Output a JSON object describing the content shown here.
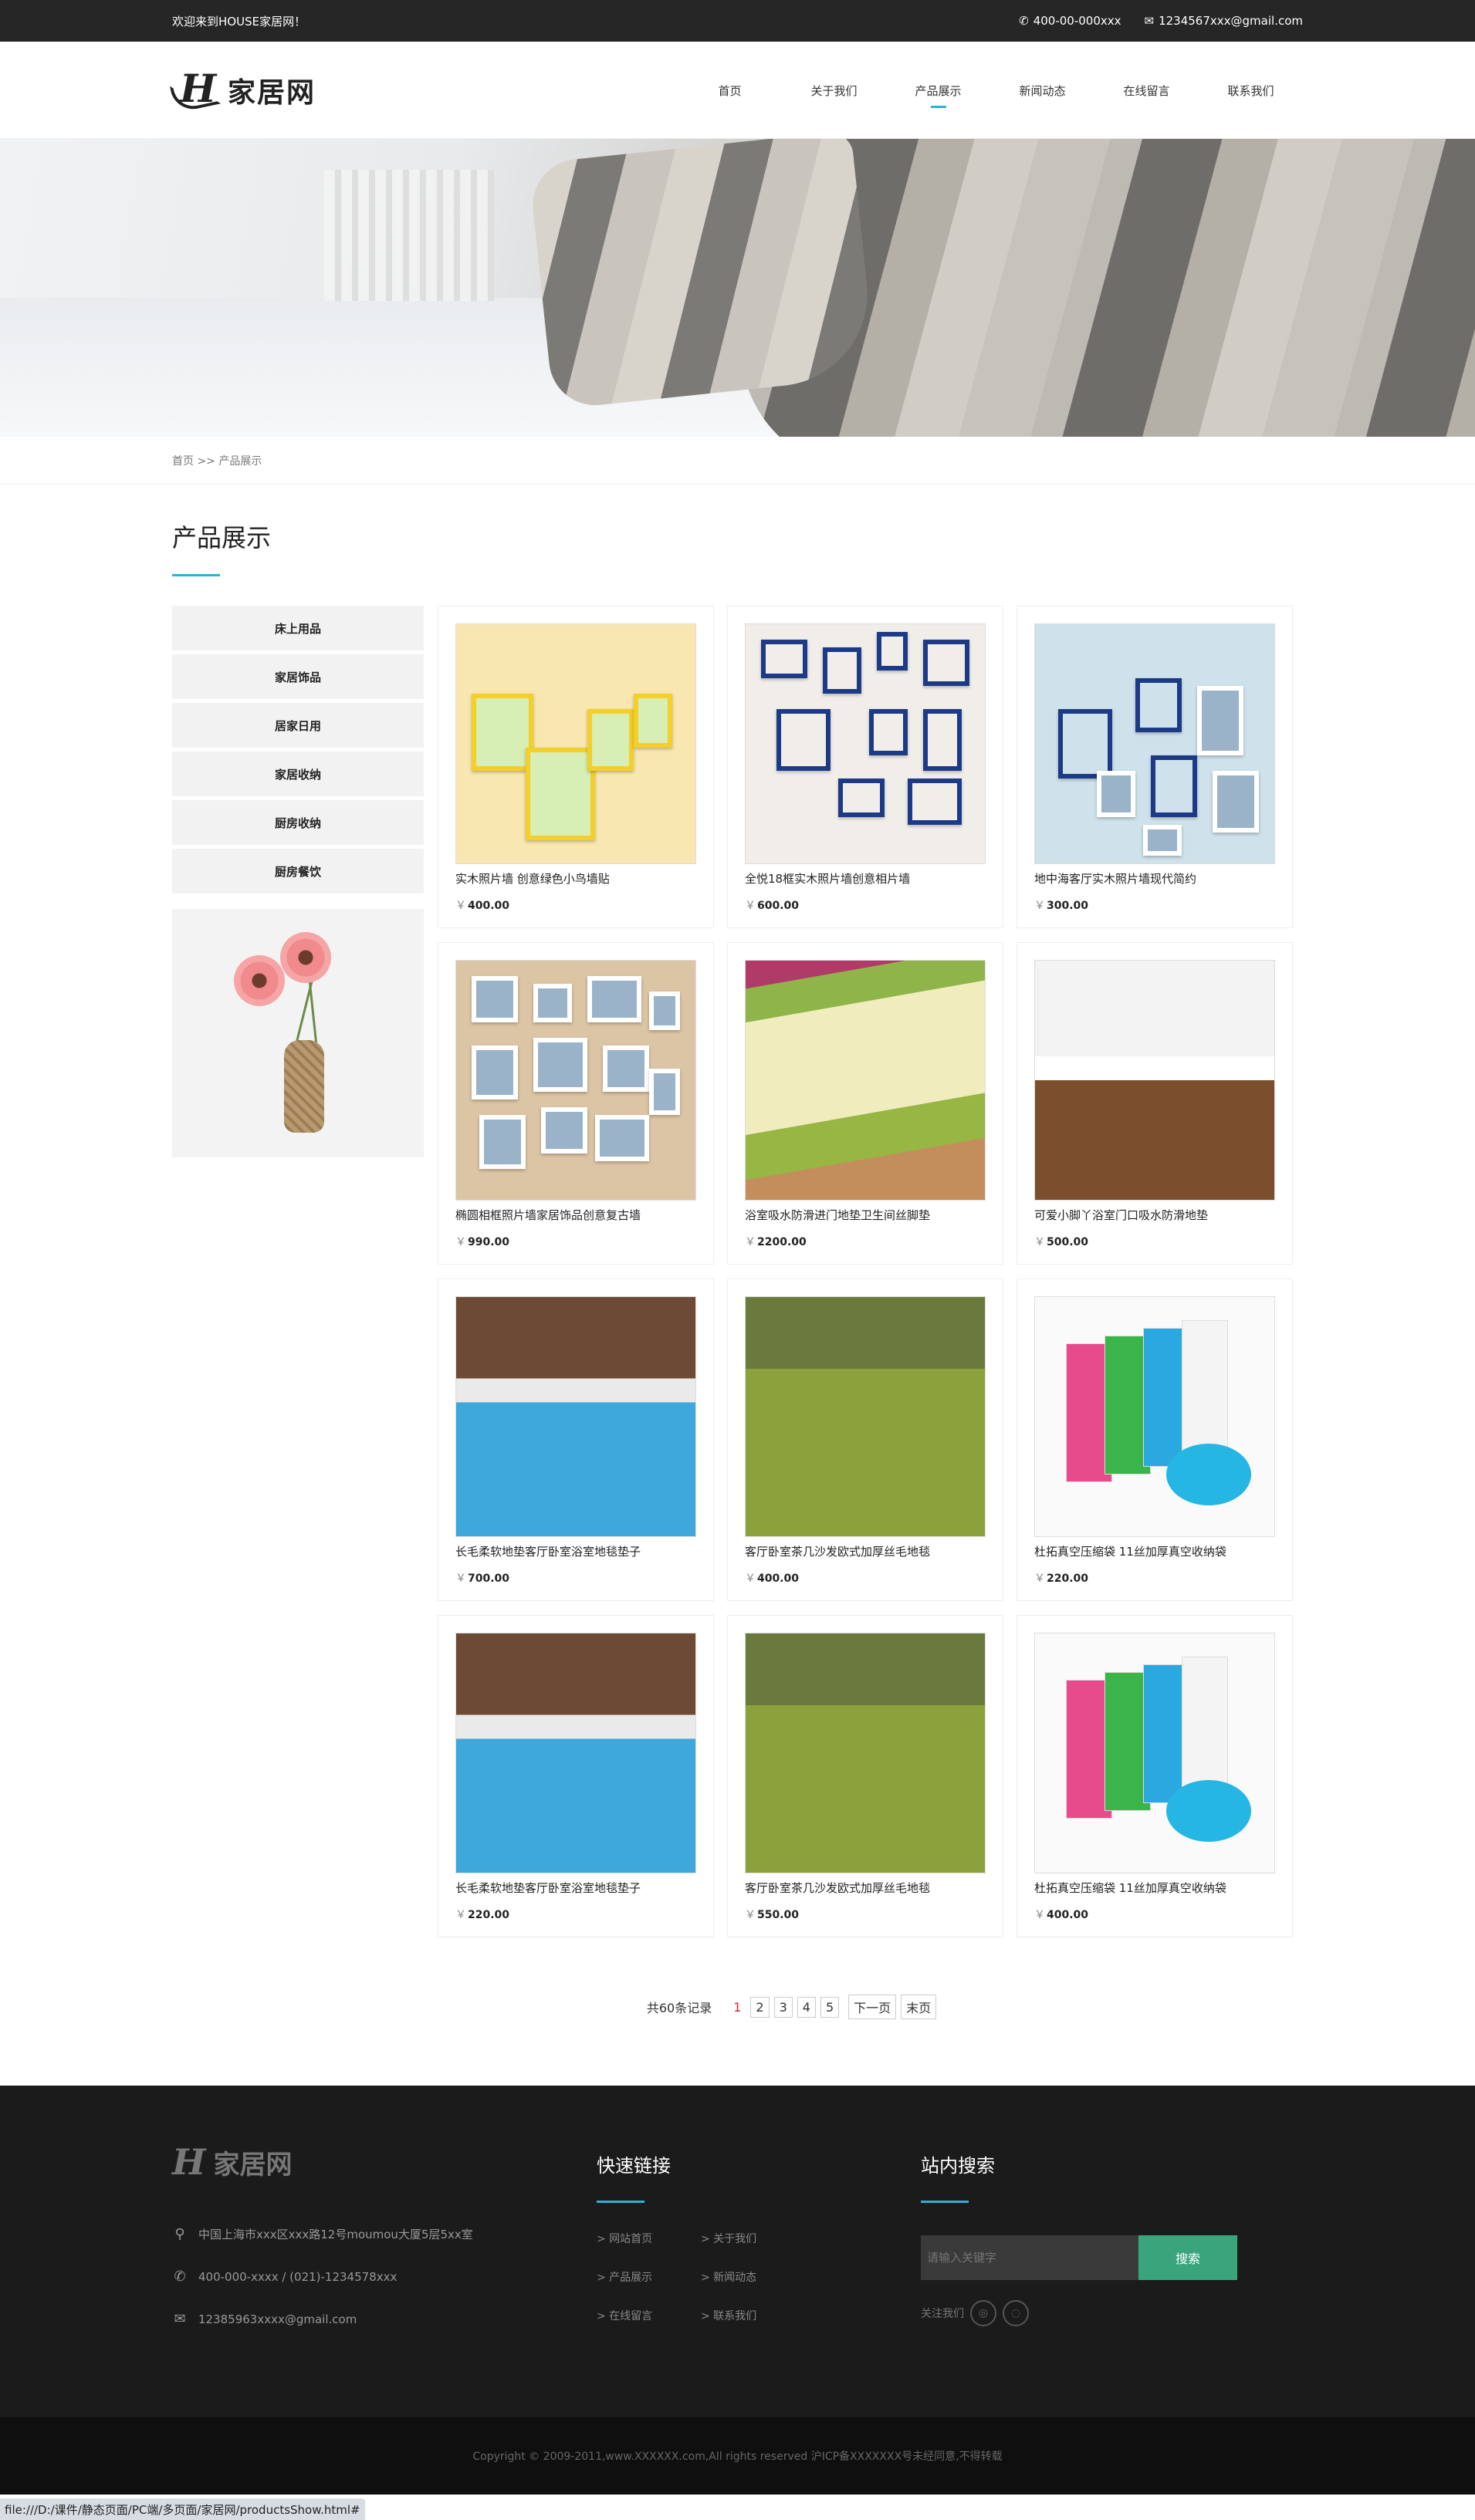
{
  "topbar": {
    "welcome": "欢迎来到HOUSE家居网！",
    "phone": "400-00-000xxx",
    "email": "1234567xxx@gmail.com"
  },
  "header": {
    "logo_letter": "H",
    "logo_text": "家居网",
    "nav": [
      {
        "label": "首页",
        "active": false
      },
      {
        "label": "关于我们",
        "active": false
      },
      {
        "label": "产品展示",
        "active": true
      },
      {
        "label": "新闻动态",
        "active": false
      },
      {
        "label": "在线留言",
        "active": false
      },
      {
        "label": "联系我们",
        "active": false
      }
    ]
  },
  "breadcrumb": "首页 >> 产品展示",
  "section_title": "产品展示",
  "categories": [
    "床上用品",
    "家居饰品",
    "居家日用",
    "家居收纳",
    "厨房收纳",
    "厨房餐饮"
  ],
  "products": [
    {
      "name": "实木照片墙 创意绿色小鸟墙贴",
      "price": "400.00",
      "art": "wall1"
    },
    {
      "name": "全悦18框实木照片墙创意相片墙",
      "price": "600.00",
      "art": "wall2"
    },
    {
      "name": "地中海客厅实木照片墙现代简约",
      "price": "300.00",
      "art": "wall3"
    },
    {
      "name": "椭圆相框照片墙家居饰品创意复古墙",
      "price": "990.00",
      "art": "wall4"
    },
    {
      "name": "浴室吸水防滑进门地垫卫生间丝脚垫",
      "price": "2200.00",
      "art": "rug1"
    },
    {
      "name": "可爱小脚丫浴室门口吸水防滑地垫",
      "price": "500.00",
      "art": "rug2"
    },
    {
      "name": "长毛柔软地垫客厅卧室浴室地毯垫子",
      "price": "700.00",
      "art": "blue"
    },
    {
      "name": "客厅卧室茶几沙发欧式加厚丝毛地毯",
      "price": "400.00",
      "art": "green"
    },
    {
      "name": "杜拓真空压缩袋 11丝加厚真空收纳袋",
      "price": "220.00",
      "art": "bag"
    },
    {
      "name": "长毛柔软地垫客厅卧室浴室地毯垫子",
      "price": "220.00",
      "art": "blue"
    },
    {
      "name": "客厅卧室茶几沙发欧式加厚丝毛地毯",
      "price": "550.00",
      "art": "green"
    },
    {
      "name": "杜拓真空压缩袋 11丝加厚真空收纳袋",
      "price": "400.00",
      "art": "bag"
    }
  ],
  "currency": "￥",
  "pager": {
    "total": "共60条记录",
    "current": "1",
    "pages": [
      "2",
      "3",
      "4",
      "5"
    ],
    "next": "下一页",
    "last": "末页"
  },
  "footer": {
    "logo_letter": "H",
    "logo_text": "家居网",
    "address": "中国上海市xxx区xxx路12号moumou大厦5层5xx室",
    "phone": "400-000-xxxx / (021)-1234578xxx",
    "email": "12385963xxxx@gmail.com",
    "links_title": "快速链接",
    "links": [
      "> 网站首页",
      "> 关于我们",
      "> 产品展示",
      "> 新闻动态",
      "> 在线留言",
      "> 联系我们"
    ],
    "search_title": "站内搜索",
    "search_placeholder": "请输入关键字",
    "search_button": "搜索",
    "follow_label": "关注我们"
  },
  "copyright": "Copyright © 2009-2011,www.XXXXXX.com,All rights reserved 沪ICP备XXXXXXX号未经同意,不得转载",
  "statusbar": "file:///D:/课件/静态页面/PC端/多页面/家居网/productsShow.html#",
  "colors": {
    "accent": "#2bb3d6",
    "search_button": "#3aa57c",
    "topbar": "#262626",
    "footer": "#1b1b1b"
  }
}
